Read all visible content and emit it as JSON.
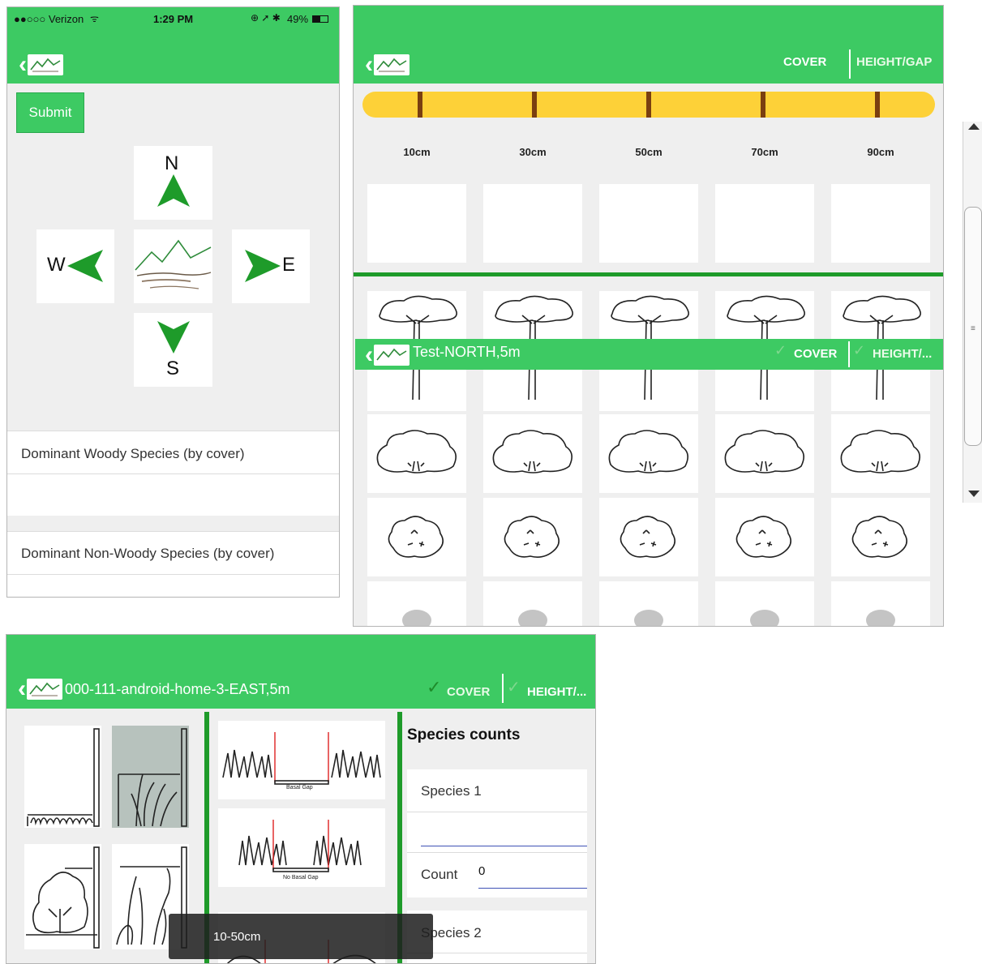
{
  "phone": {
    "status_bar": {
      "carrier": "●●○○○ Verizon",
      "time": "1:29 PM",
      "battery": "49%"
    },
    "submit_label": "Submit",
    "compass": {
      "north": "N",
      "south": "S",
      "west": "W",
      "east": "E"
    },
    "rows": [
      {
        "label": "Dominant Woody Species (by cover)"
      },
      {
        "label": "Dominant Non-Woody Species (by cover)"
      }
    ]
  },
  "tablet_top": {
    "tabs": {
      "cover": "COVER",
      "height_gap": "HEIGHT/GAP"
    },
    "ruler_labels": [
      "10cm",
      "30cm",
      "50cm",
      "70cm",
      "90cm"
    ],
    "overlay_header": {
      "title": "Test-NORTH,5m",
      "cover": "COVER",
      "height_gap": "HEIGHT/..."
    }
  },
  "tablet_bottom": {
    "header": {
      "title": "000-111-android-home-3-EAST,5m",
      "cover": "COVER",
      "height_gap": "HEIGHT/..."
    },
    "diagram_labels": {
      "basal_gap": "Basal Gap",
      "no_basal_gap": "No Basal Gap"
    },
    "species_title": "Species counts",
    "species_1": "Species 1",
    "count_label": "Count",
    "count_value": "0",
    "species_2": "Species 2",
    "toast": "10-50cm"
  },
  "colors": {
    "accent_green": "#3dca63",
    "dark_green": "#1f9a2a",
    "ruler_yellow": "#fdd138"
  }
}
